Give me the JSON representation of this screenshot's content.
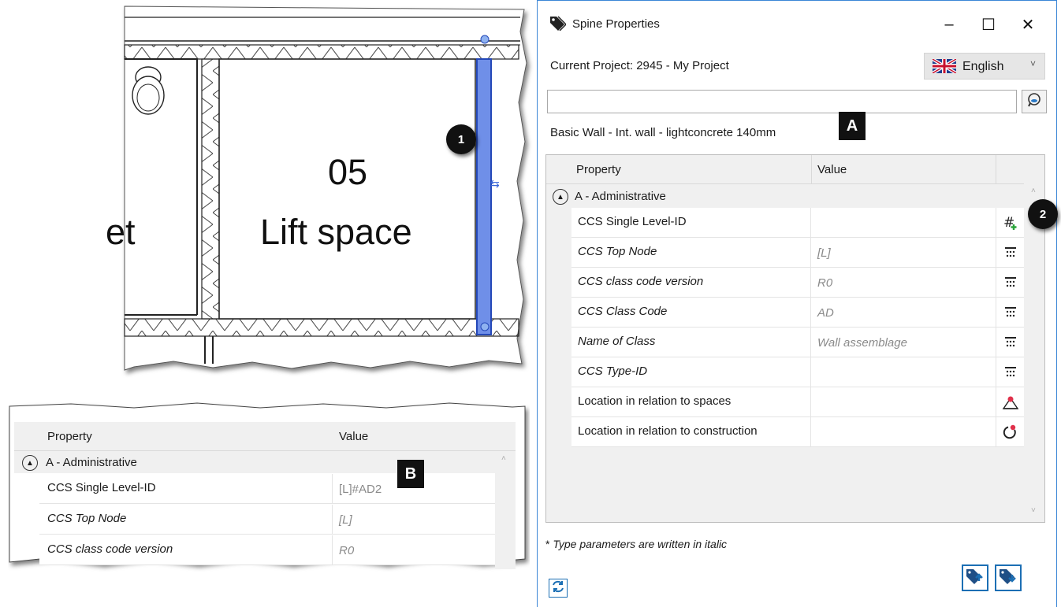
{
  "plan": {
    "room_number": "05",
    "room_name": "Lift space",
    "neighbor_fragment": "et"
  },
  "mini_grid": {
    "header": {
      "property": "Property",
      "value": "Value"
    },
    "group": "A - Administrative",
    "rows": [
      {
        "name": "CCS Single Level-ID",
        "value": "[L]#AD2",
        "italic": false
      },
      {
        "name": "CCS Top Node",
        "value": "[L]",
        "italic": true
      },
      {
        "name": "CCS class code version",
        "value": "R0",
        "italic": true
      }
    ]
  },
  "dialog": {
    "title": "Spine Properties",
    "controls": {
      "minimize": "–",
      "maximize": "☐",
      "close": "✕"
    },
    "project_label": "Current Project: 2945 - My Project",
    "language": "English",
    "search_value": "",
    "element_label": "Basic Wall - Int. wall - lightconcrete 140mm",
    "grid": {
      "header": {
        "property": "Property",
        "value": "Value"
      },
      "group": "A - Administrative",
      "rows": [
        {
          "name": "CCS Single Level-ID",
          "value": "",
          "italic": false,
          "icon": "add-hash-icon"
        },
        {
          "name": "CCS Top Node",
          "value": "[L]",
          "italic": true,
          "icon": "list-icon"
        },
        {
          "name": "CCS class code version",
          "value": "R0",
          "italic": true,
          "icon": "list-icon"
        },
        {
          "name": "CCS Class Code",
          "value": "AD",
          "italic": true,
          "icon": "list-icon"
        },
        {
          "name": "Name of Class",
          "value": "Wall assemblage",
          "italic": true,
          "icon": "list-icon"
        },
        {
          "name": "CCS Type-ID",
          "value": "",
          "italic": true,
          "icon": "list-icon"
        },
        {
          "name": "Location in relation to spaces",
          "value": "",
          "italic": false,
          "icon": "location-spaces-icon"
        },
        {
          "name": "Location in relation to construction",
          "value": "",
          "italic": false,
          "icon": "location-construction-icon"
        }
      ]
    },
    "note_star": "*",
    "note": " Type parameters are written in italic"
  },
  "callouts": {
    "one": "1",
    "two": "2",
    "a": "A",
    "b": "B"
  },
  "colors": {
    "accent": "#1c6fb4",
    "wall_highlight": "#5b7fe0",
    "border": "#3b86d6"
  }
}
